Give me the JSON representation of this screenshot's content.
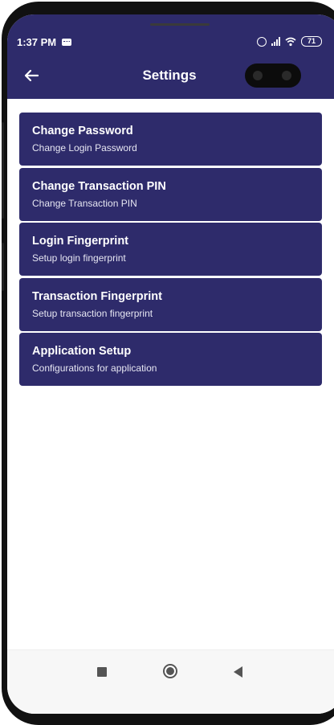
{
  "status_bar": {
    "time": "1:37 PM",
    "battery": "71",
    "icons": [
      "message-icon",
      "alarm-icon",
      "signal-icon",
      "wifi-icon",
      "battery-icon"
    ]
  },
  "header": {
    "title": "Settings",
    "back_icon": "back-arrow-icon"
  },
  "settings_items": [
    {
      "title": "Change Password",
      "subtitle": "Change Login Password"
    },
    {
      "title": "Change Transaction PIN",
      "subtitle": "Change Transaction PIN"
    },
    {
      "title": "Login Fingerprint",
      "subtitle": "Setup login fingerprint"
    },
    {
      "title": "Transaction Fingerprint",
      "subtitle": "Setup transaction fingerprint"
    },
    {
      "title": "Application Setup",
      "subtitle": "Configurations for application"
    }
  ],
  "nav_bar": {
    "icons": [
      "recents-icon",
      "home-icon",
      "back-icon"
    ]
  },
  "colors": {
    "primary": "#2e2b6b",
    "text_on_primary": "#ffffff",
    "background": "#ffffff"
  }
}
